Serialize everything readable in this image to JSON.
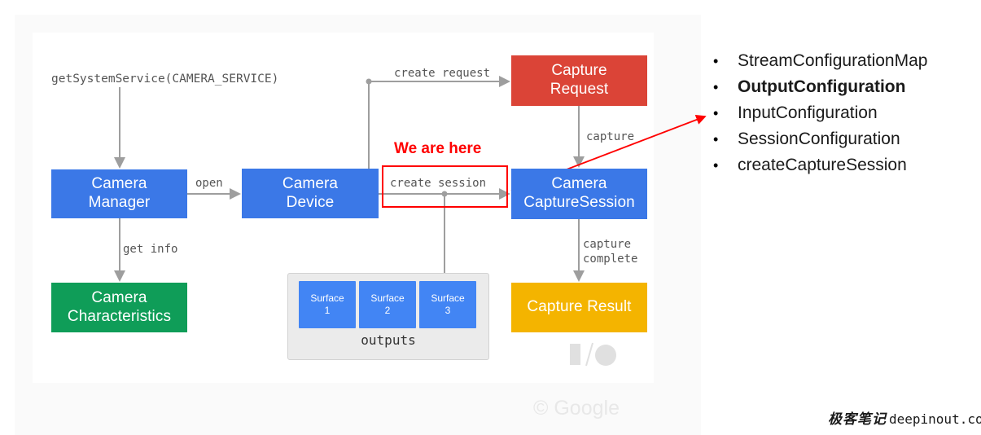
{
  "slide": {
    "copyright": "© Google",
    "io_logo_name": "google-io-logo"
  },
  "diagram": {
    "nodes": {
      "camera_manager": {
        "label": "Camera\nManager",
        "color": "#3b78e7"
      },
      "camera_device": {
        "label": "Camera\nDevice",
        "color": "#3b78e7"
      },
      "capture_request": {
        "label": "Capture\nRequest",
        "color": "#db4437"
      },
      "camera_capture_session": {
        "label": "Camera\nCaptureSession",
        "color": "#3b78e7"
      },
      "camera_characteristics": {
        "label": "Camera\nCharacteristics",
        "color": "#0f9d58"
      },
      "capture_result": {
        "label": "Capture Result",
        "color": "#f4b400"
      }
    },
    "edge_labels": {
      "get_system_service": "getSystemService(CAMERA_SERVICE)",
      "open": "open",
      "create_request": "create request",
      "get_info": "get info",
      "capture": "capture",
      "capture_complete": "capture\ncomplete",
      "create_session": "create session"
    },
    "outputs": {
      "group_label": "outputs",
      "surfaces": [
        {
          "name": "Surface",
          "index": "1"
        },
        {
          "name": "Surface",
          "index": "2"
        },
        {
          "name": "Surface",
          "index": "3"
        }
      ]
    },
    "highlight": {
      "callout_text": "We are here",
      "callout_color": "#ff0000",
      "target_label": "create session"
    }
  },
  "bullets": {
    "items": [
      {
        "label": "StreamConfigurationMap",
        "bold": false
      },
      {
        "label": "OutputConfiguration",
        "bold": true
      },
      {
        "label": "InputConfiguration",
        "bold": false
      },
      {
        "label": "SessionConfiguration",
        "bold": false
      },
      {
        "label": "createCaptureSession",
        "bold": false
      }
    ],
    "marker": "•"
  },
  "watermark": {
    "cn": "极客笔记",
    "domain": "deepinout.com"
  }
}
